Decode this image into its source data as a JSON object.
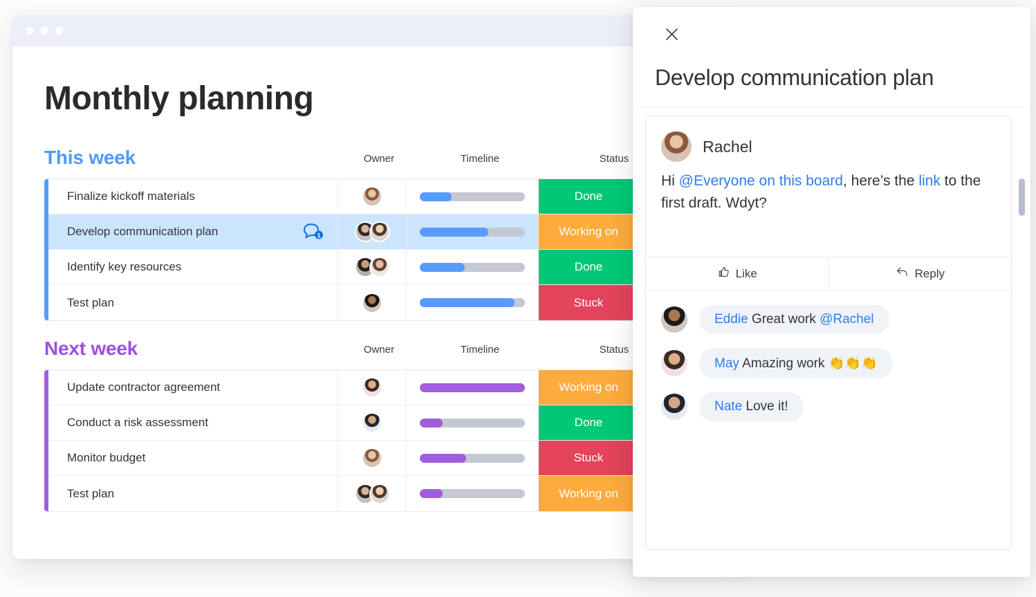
{
  "window": {
    "chrome_dots": 3
  },
  "board": {
    "title": "Monthly planning",
    "columns": {
      "owner": "Owner",
      "timeline": "Timeline",
      "status": "Status"
    },
    "groups": [
      {
        "name": "This week",
        "accent": "#579bfc",
        "bar_color": "#579bfc",
        "rows": [
          {
            "task": "Finalize kickoff materials",
            "owners": 1,
            "progress": 30,
            "status": "Done",
            "status_color": "#00c875",
            "selected": false,
            "updates": null
          },
          {
            "task": "Develop communication plan",
            "owners": 2,
            "progress": 65,
            "status": "Working on",
            "status_color": "#fdab3d",
            "selected": true,
            "updates": "1"
          },
          {
            "task": "Identify key resources",
            "owners": 2,
            "progress": 43,
            "status": "Done",
            "status_color": "#00c875",
            "selected": false,
            "updates": null
          },
          {
            "task": "Test plan",
            "owners": 1,
            "progress": 90,
            "status": "Stuck",
            "status_color": "#e2445c",
            "selected": false,
            "updates": null
          }
        ]
      },
      {
        "name": "Next week",
        "accent": "#a25ddc",
        "bar_color": "#a25ddc",
        "rows": [
          {
            "task": "Update contractor agreement",
            "owners": 1,
            "progress": 100,
            "status": "Working on",
            "status_color": "#fdab3d",
            "selected": false,
            "updates": null
          },
          {
            "task": "Conduct a risk assessment",
            "owners": 1,
            "progress": 22,
            "status": "Done",
            "status_color": "#00c875",
            "selected": false,
            "updates": null
          },
          {
            "task": "Monitor budget",
            "owners": 1,
            "progress": 44,
            "status": "Stuck",
            "status_color": "#e2445c",
            "selected": false,
            "updates": null
          },
          {
            "task": "Test plan",
            "owners": 2,
            "progress": 22,
            "status": "Working on",
            "status_color": "#fdab3d",
            "selected": false,
            "updates": null
          }
        ]
      }
    ]
  },
  "panel": {
    "close_label": "×",
    "title": "Develop communication plan",
    "post": {
      "author": "Rachel",
      "text_parts": [
        {
          "t": "Hi ",
          "type": "plain"
        },
        {
          "t": "@Everyone on this board",
          "type": "mention"
        },
        {
          "t": ", here’s the ",
          "type": "plain"
        },
        {
          "t": "link",
          "type": "link"
        },
        {
          "t": " to the first draft. Wdyt?",
          "type": "plain"
        }
      ]
    },
    "actions": [
      {
        "label": "Like",
        "icon": "thumbs-up-icon"
      },
      {
        "label": "Reply",
        "icon": "reply-arrow-icon"
      }
    ],
    "replies": [
      {
        "name": "Eddie",
        "text": " Great work ",
        "mention": "@Rachel",
        "tail": ""
      },
      {
        "name": "May",
        "text": " Amazing work ",
        "mention": "",
        "tail": "👏👏👏"
      },
      {
        "name": "Nate",
        "text": " Love it!",
        "mention": "",
        "tail": ""
      }
    ]
  },
  "colors": {
    "done": "#00c875",
    "working_on": "#fdab3d",
    "stuck": "#e2445c",
    "accent_blue": "#579bfc",
    "accent_purple": "#a25ddc",
    "link": "#2e7bf0",
    "selected_row": "#cce5ff"
  }
}
